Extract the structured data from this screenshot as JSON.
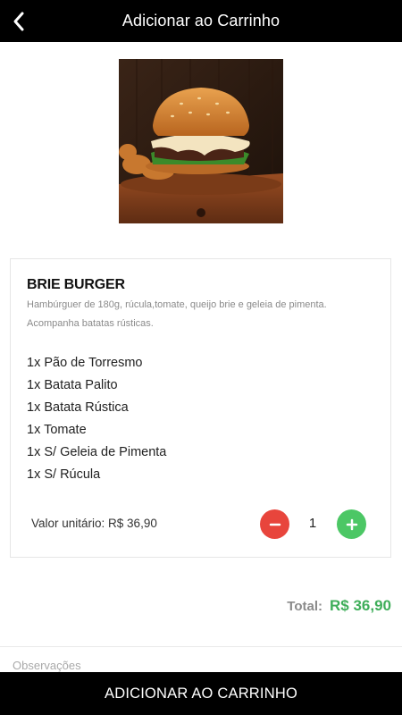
{
  "header": {
    "title": "Adicionar ao Carrinho"
  },
  "product": {
    "name": "BRIE BURGER",
    "description": "Hambúrguer de 180g, rúcula,tomate, queijo brie e geleia de pimenta. Acompanha batatas rústicas.",
    "items": [
      "1x Pão de Torresmo",
      "1x Batata Palito",
      "1x Batata Rústica",
      "1x Tomate",
      "1x S/ Geleia de Pimenta",
      "1x S/ Rúcula"
    ],
    "unit_price": "Valor unitário: R$ 36,90",
    "quantity": "1"
  },
  "total": {
    "label": "Total:",
    "value": "R$ 36,90"
  },
  "notes": {
    "placeholder": "Observações",
    "value": ""
  },
  "footer": {
    "button_label": "ADICIONAR AO CARRINHO"
  },
  "icons": {
    "back": "chevron-left-icon",
    "minus": "minus-icon",
    "plus": "plus-icon"
  },
  "colors": {
    "topbar": "#000000",
    "minus_button": "#e8453c",
    "plus_button": "#4cc765",
    "total_value": "#3fae5a"
  }
}
